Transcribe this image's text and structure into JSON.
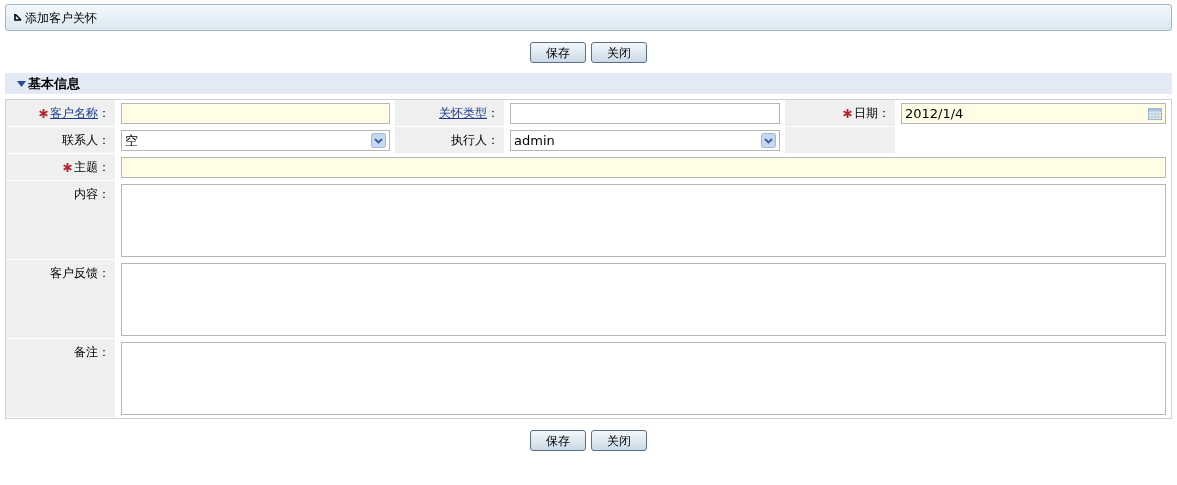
{
  "header": {
    "title": "添加客户关怀"
  },
  "top_buttons": [
    "保存",
    "关闭"
  ],
  "section": {
    "title": "基本信息",
    "expanded": true
  },
  "rows": [
    [
      {
        "label": "客户名称",
        "colon": "：",
        "required": true,
        "link": true,
        "kind": "text"
      },
      {
        "label": "关怀类型",
        "colon": "：",
        "required": false,
        "link": true,
        "kind": "text"
      },
      {
        "label": "日期",
        "colon": "：",
        "required": true,
        "link": false,
        "kind": "date",
        "value": "2012/1/4"
      }
    ],
    [
      {
        "label": "联系人",
        "colon": "：",
        "required": false,
        "link": false,
        "kind": "select",
        "value": "空"
      },
      {
        "label": "执行人",
        "colon": "：",
        "required": false,
        "link": false,
        "kind": "select",
        "value": "admin"
      }
    ],
    [
      {
        "label": "主题",
        "colon": "：",
        "required": true,
        "link": false,
        "kind": "text"
      }
    ],
    [
      {
        "label": "内容",
        "colon": "：",
        "required": false,
        "link": false,
        "kind": "textarea"
      }
    ],
    [
      {
        "label": "客户反馈",
        "colon": "：",
        "required": false,
        "link": false,
        "kind": "textarea"
      }
    ],
    [
      {
        "label": "备注",
        "colon": "：",
        "required": false,
        "link": false,
        "kind": "textarea"
      }
    ]
  ],
  "bottom_buttons": [
    "保存",
    "关闭"
  ]
}
